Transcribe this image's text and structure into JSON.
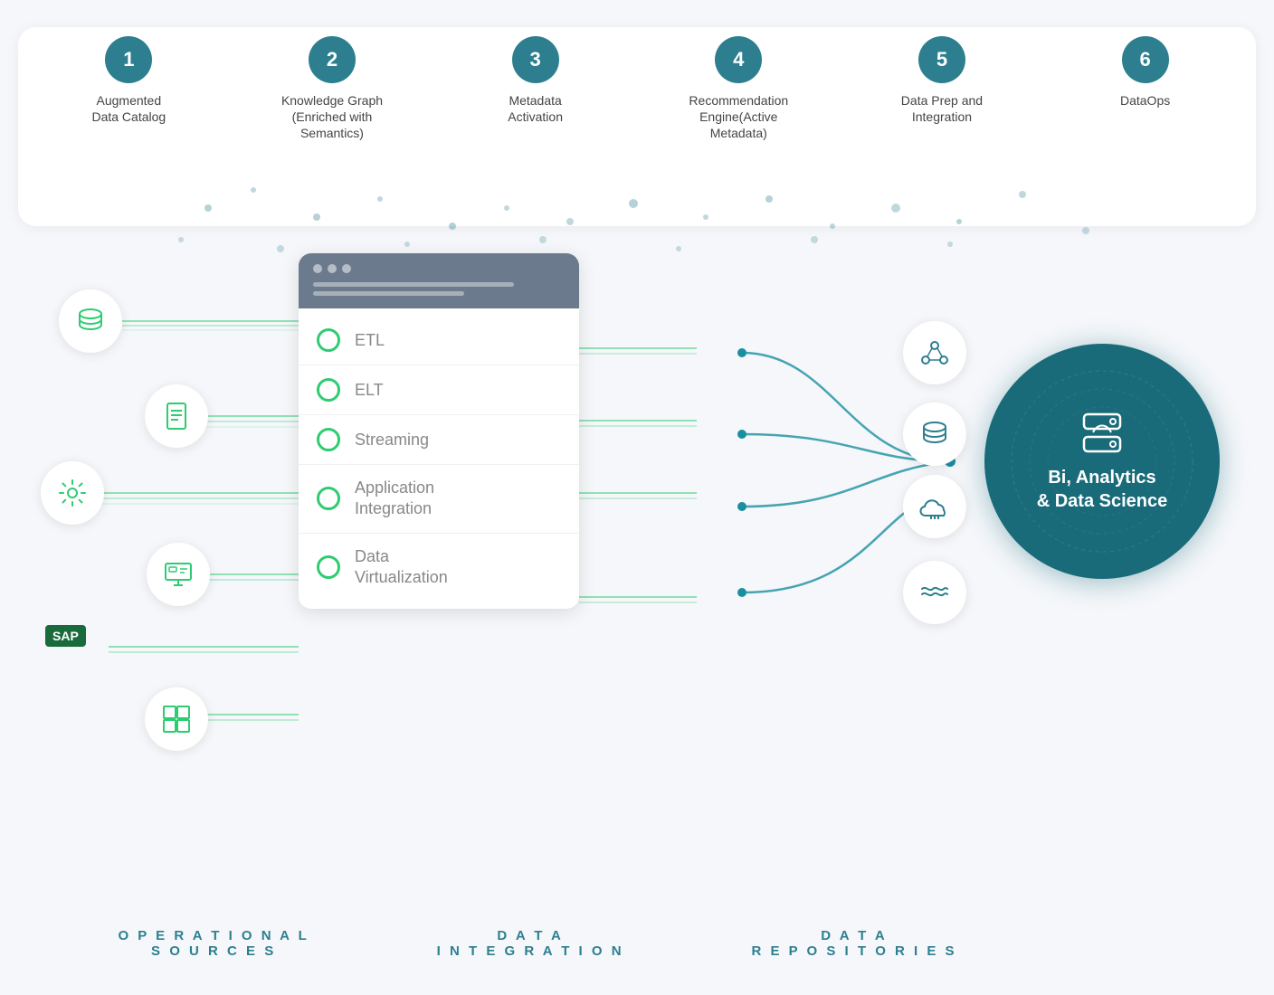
{
  "steps": [
    {
      "number": "1",
      "label": "Augmented\nData Catalog"
    },
    {
      "number": "2",
      "label": "Knowledge Graph\n(Enriched with\nSemantics)"
    },
    {
      "number": "3",
      "label": "Metadata\nActivation"
    },
    {
      "number": "4",
      "label": "Recommendation\nEngine(Active\nMetadata)"
    },
    {
      "number": "5",
      "label": "Data Prep and\nIntegration"
    },
    {
      "number": "6",
      "label": "DataOps"
    }
  ],
  "integration_items": [
    {
      "label": "ETL"
    },
    {
      "label": "ELT"
    },
    {
      "label": "Streaming"
    },
    {
      "label": "Application\nIntegration"
    },
    {
      "label": "Data\nVirtualization"
    }
  ],
  "bi": {
    "title": "Bi, Analytics\n& Data Science"
  },
  "bottom_labels": [
    {
      "line1": "OPERATIONAL",
      "line2": "SOURCES"
    },
    {
      "line1": "DATA",
      "line2": "INTEGRATION"
    },
    {
      "line1": "DATA",
      "line2": "REPOSITORIES"
    }
  ],
  "accent_color": "#2d7f8f",
  "green_color": "#2ecc71"
}
